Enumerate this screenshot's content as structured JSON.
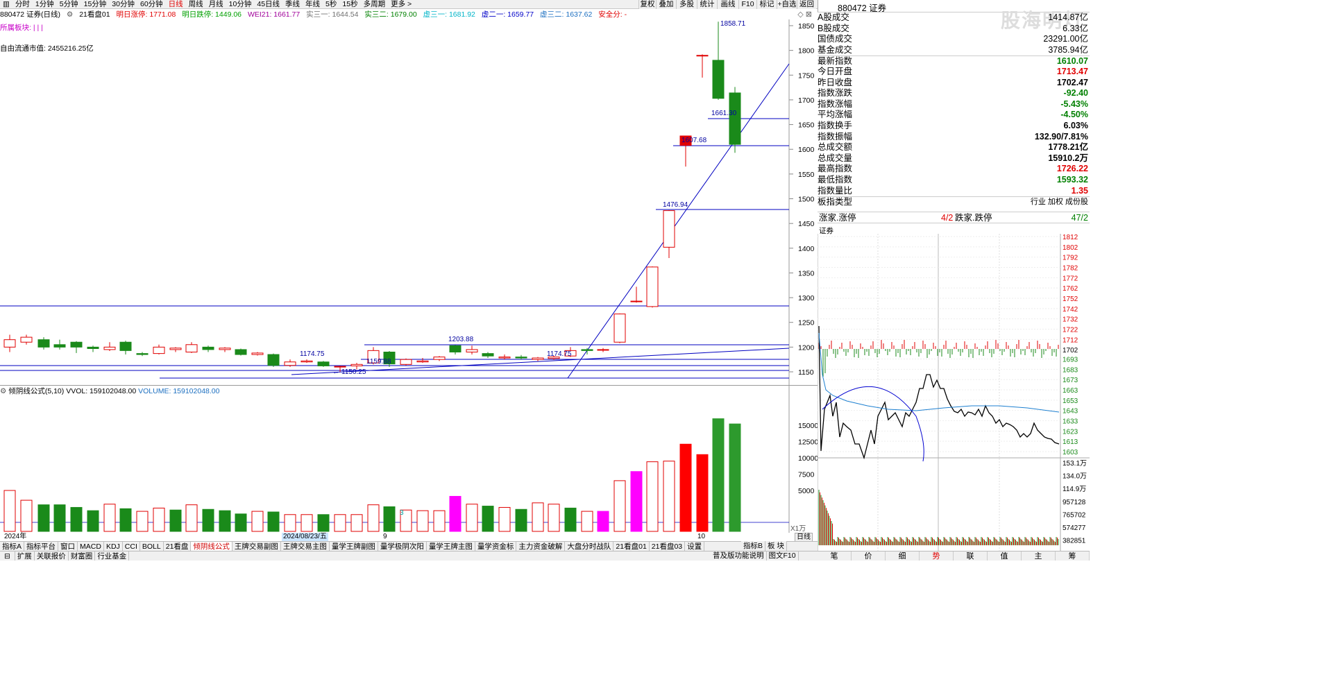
{
  "toolbar": {
    "periods": [
      "分时",
      "1分钟",
      "5分钟",
      "15分钟",
      "30分钟",
      "60分钟",
      "日线",
      "周线",
      "月线",
      "10分钟",
      "45日线",
      "季线",
      "年线",
      "5秒",
      "15秒",
      "多周期",
      "更多 >"
    ],
    "active_period": "日线",
    "right_buttons": [
      "复权",
      "叠加",
      "多股",
      "统计",
      "画线",
      "F10",
      "标记",
      "+自选",
      "返回"
    ]
  },
  "info": {
    "code_name": "880472 证券(日线)",
    "formula": "21看盘01",
    "limit_up": "明日涨停: 1771.08",
    "limit_down": "明日跌停: 1449.06",
    "wei21": "WEI21: 1661.77",
    "shi31": "实三一: 1644.54",
    "shi32": "实三二: 1679.00",
    "xu31": "虚三一: 1681.92",
    "xu21": "虚二一: 1659.77",
    "xu32": "虚三二: 1637.62",
    "safety": "安全分: -",
    "sector": "所属板块: | | |",
    "float_mv": "自由流通市值: 2455216.25亿"
  },
  "price_labels": {
    "p1858": "1858.71",
    "p1661": "1661.30",
    "p1607": "1607.68",
    "p1476": "1476.94",
    "p1203": "1203.88",
    "p1174a": "1174.75",
    "p1174b": "1174.75",
    "p1159": "1159.88",
    "p1150": "1150.25"
  },
  "price_axis": [
    "1850",
    "1800",
    "1750",
    "1700",
    "1650",
    "1600",
    "1550",
    "1500",
    "1450",
    "1400",
    "1350",
    "1300",
    "1250",
    "1200",
    "1150"
  ],
  "vol_header": {
    "name": "倾阴线公式(5,10)",
    "vvol": "VVOL: 159102048.00",
    "volume": "VOLUME: 159102048.00"
  },
  "vol_axis": [
    "15000",
    "12500",
    "10000",
    "7500",
    "5000"
  ],
  "vol_unit": "X1万",
  "vol_marker": "3",
  "dates": {
    "year": "2024年",
    "sel": "2024/08/23/五",
    "m9": "9",
    "m10": "10",
    "period": "日线"
  },
  "bottom_tabs": [
    "指标A",
    "指标平台",
    "窗口",
    "MACD",
    "KDJ",
    "CCI",
    "BOLL",
    "21看盘",
    "倾阴线公式",
    "王牌交易副图",
    "王牌交易主图",
    "量学王牌副图",
    "量学极阴次阳",
    "量学王牌主图",
    "量学资金标",
    "主力资金破解",
    "大盘分时战队",
    "21看盘01",
    "21看盘03",
    "设置"
  ],
  "bottom_tabs_active": "倾阴线公式",
  "bottom_right": [
    "指标B",
    "板 块"
  ],
  "row2": [
    "扩展",
    "关联报价",
    "财富圈",
    "行业基金"
  ],
  "row2_right": [
    "普及版功能说明",
    "图文F10"
  ],
  "quote": {
    "header": "880472 证券",
    "rows": [
      {
        "k": "A股成交",
        "v": "1414.87亿",
        "c": "#000"
      },
      {
        "k": "B股成交",
        "v": "6.33亿",
        "c": "#000"
      },
      {
        "k": "国债成交",
        "v": "23291.00亿",
        "c": "#000"
      },
      {
        "k": "基金成交",
        "v": "3785.94亿",
        "c": "#000"
      },
      {
        "k": "最新指数",
        "v": "1610.07",
        "c": "#008000"
      },
      {
        "k": "今日开盘",
        "v": "1713.47",
        "c": "#e00000"
      },
      {
        "k": "昨日收盘",
        "v": "1702.47",
        "c": "#000"
      },
      {
        "k": "指数涨跌",
        "v": "-92.40",
        "c": "#008000"
      },
      {
        "k": "指数涨幅",
        "v": "-5.43%",
        "c": "#008000"
      },
      {
        "k": "平均涨幅",
        "v": "-4.50%",
        "c": "#008000"
      },
      {
        "k": "指数换手",
        "v": "6.03%",
        "c": "#000"
      },
      {
        "k": "指数振幅",
        "v": "132.90/7.81%",
        "c": "#000"
      },
      {
        "k": "总成交额",
        "v": "1778.21亿",
        "c": "#000"
      },
      {
        "k": "总成交量",
        "v": "15910.2万",
        "c": "#000"
      },
      {
        "k": "最高指数",
        "v": "1726.22",
        "c": "#e00000"
      },
      {
        "k": "最低指数",
        "v": "1593.32",
        "c": "#008000"
      },
      {
        "k": "指数量比",
        "v": "1.35",
        "c": "#e00000"
      },
      {
        "k": "板指类型",
        "v": "行业 加权 成份股",
        "c": "#000"
      }
    ],
    "updown_label1": "涨家.涨停",
    "updown_val1": "4/2",
    "updown_label2": "跌家.跌停",
    "updown_val2": "47/2"
  },
  "watermark": "股海明灯",
  "mini": {
    "title": "证券",
    "price_axis": [
      "1812",
      "1802",
      "1792",
      "1782",
      "1772",
      "1762",
      "1752",
      "1742",
      "1732",
      "1722",
      "1712",
      "1702",
      "1693",
      "1683",
      "1673",
      "1663",
      "1653",
      "1643",
      "1633",
      "1623",
      "1613",
      "1603"
    ],
    "vol_axis": [
      "153.1万",
      "134.0万",
      "114.9万",
      "957128",
      "765702",
      "574277",
      "382851",
      "191426"
    ],
    "tabs": [
      "笔",
      "价",
      "细",
      "势",
      "联",
      "值",
      "主",
      "筹"
    ],
    "active_tab": "势"
  }
}
